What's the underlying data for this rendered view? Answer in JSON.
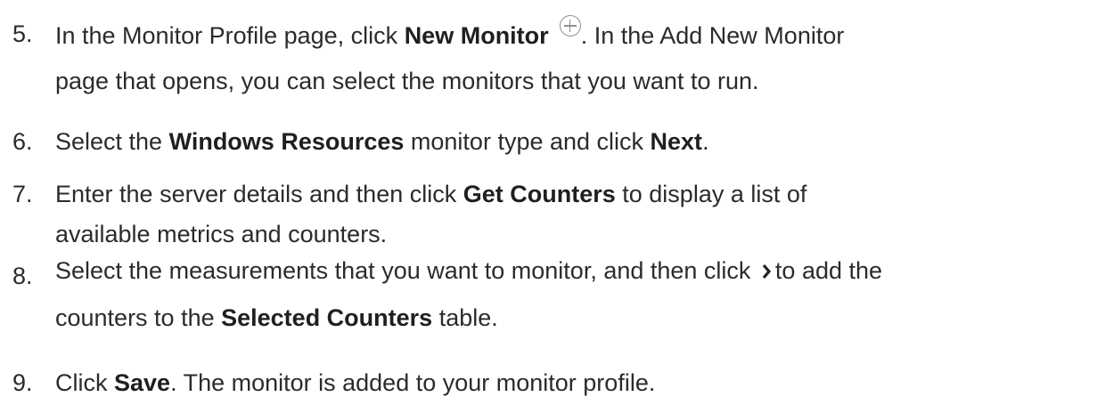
{
  "steps": [
    {
      "number": "5.",
      "line1_a": "In the Monitor Profile page, click ",
      "line1_bold": "New Monitor",
      "line1_b": ". In the Add New Monitor",
      "line2": "page that opens, you can select the monitors that you want to run.",
      "icon": "plus-circle-icon"
    },
    {
      "number": "6.",
      "a": "Select the ",
      "bold1": "Windows Resources",
      "b": " monitor type and click ",
      "bold2": "Next",
      "c": "."
    },
    {
      "number": "7.",
      "line1_a": "Enter the server details and then click ",
      "line1_bold": "Get Counters",
      "line1_b": " to display a list of",
      "line2": "available metrics and counters."
    },
    {
      "number": "8.",
      "line1_a": "Select the measurements that you want to monitor, and then click ",
      "line1_b": "to add the",
      "line2_a": "counters to the ",
      "line2_bold": "Selected Counters",
      "line2_b": " table.",
      "icon": "chevron-right-icon"
    },
    {
      "number": "9.",
      "a": "Click ",
      "bold": "Save",
      "b": ". The monitor is added to your monitor profile."
    }
  ],
  "colors": {
    "text": "#2b2b2b",
    "icon": "#8f8f8f"
  }
}
